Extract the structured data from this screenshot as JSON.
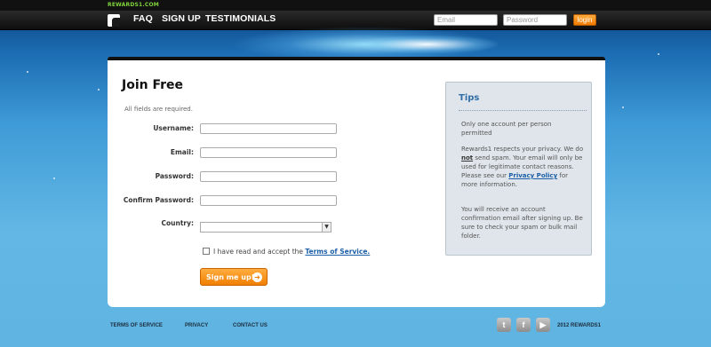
{
  "header": {
    "brand": "REWARDS1.COM",
    "nav": [
      "FAQ",
      "SIGN UP",
      "TESTIMONIALS"
    ],
    "email_placeholder": "Email",
    "password_placeholder": "Password",
    "login_label": "login"
  },
  "form": {
    "title": "Join Free",
    "required_note": "All fields are required.",
    "fields": [
      {
        "label": "Username:"
      },
      {
        "label": "Email:"
      },
      {
        "label": "Password:"
      },
      {
        "label": "Confirm Password:"
      },
      {
        "label": "Country:"
      }
    ],
    "country_value": "",
    "tos_prefix": "I have read and accept the",
    "tos_link": "Terms of Service.",
    "tos_checked": false,
    "submit_label": "Sign me up!"
  },
  "tips": {
    "title": "Tips",
    "p1": "Only one account per person permitted",
    "p2_a": "Rewards1 respects your privacy. We do",
    "p2_not": "not",
    "p2_b": "send spam. Your email will only be used for legitimate contact reasons. Please see our",
    "p2_link": "Privacy Policy",
    "p2_c": "for more information.",
    "p3": "You will receive an account confirmation email after signing up. Be sure to check your spam or bulk mail folder."
  },
  "footer": {
    "links": [
      "TERMS OF SERVICE",
      "PRIVACY",
      "CONTACT US"
    ],
    "social_icons": [
      "twitter-icon",
      "facebook-icon",
      "youtube-icon"
    ],
    "copyright": "2012 REWARDS1"
  }
}
